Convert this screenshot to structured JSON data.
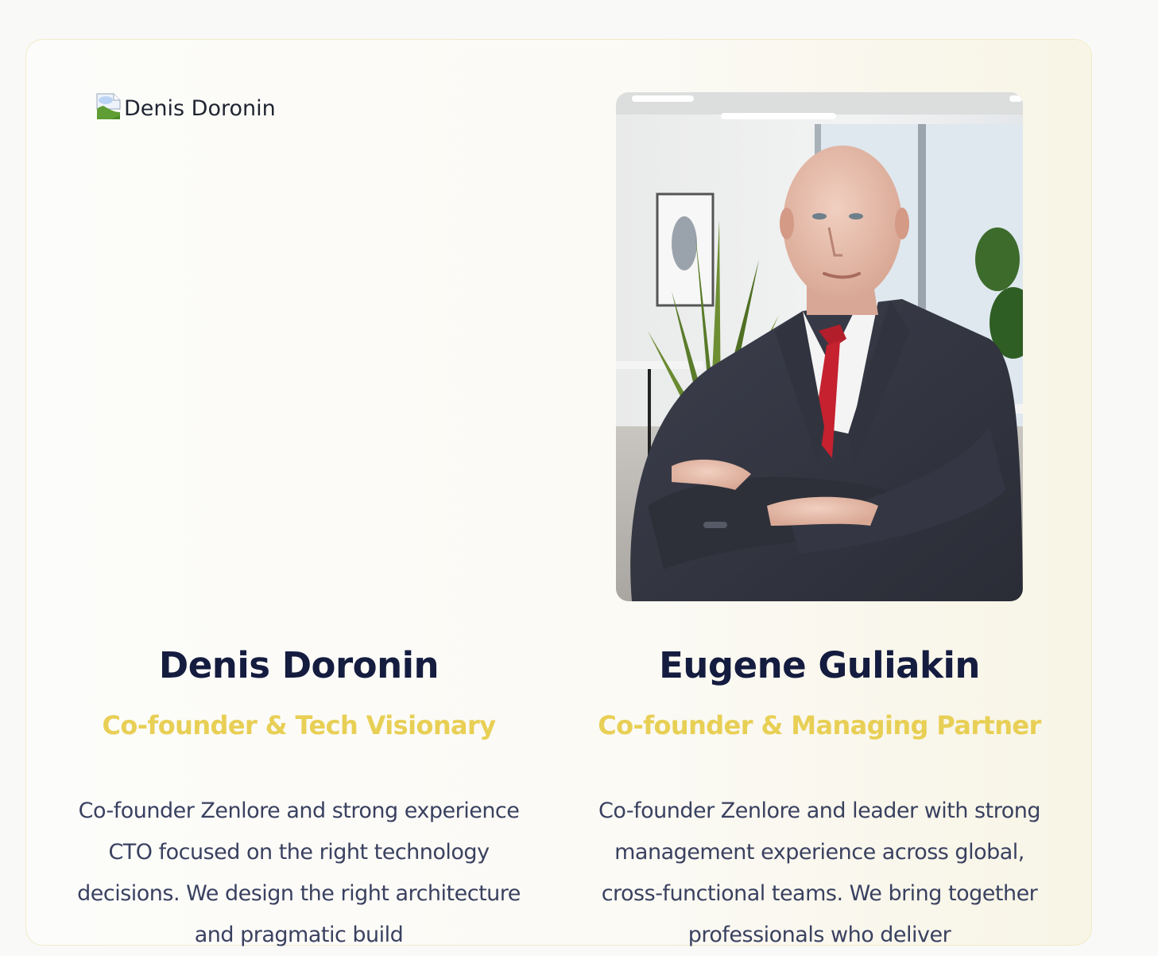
{
  "team": {
    "members": [
      {
        "image_alt": "Denis Doronin",
        "name": "Denis Doronin",
        "role": "Co-founder & Tech Visionary",
        "bio": "Co-founder Zenlore and strong experience CTO focused on the right technology decisions. We design the right architecture and pragmatic build"
      },
      {
        "image_alt": "Eugene Guliakin",
        "name": "Eugene Guliakin",
        "role": "Co-founder & Managing Partner",
        "bio": "Co-founder Zenlore and leader with strong management experience across global, cross-functional teams. We bring together professionals who deliver"
      }
    ]
  },
  "colors": {
    "name": "#141c3f",
    "role_accent": "#e8cf55",
    "body_text": "#3a4160",
    "card_border": "#f1ebc8"
  },
  "icons": [
    "broken-image-icon"
  ]
}
